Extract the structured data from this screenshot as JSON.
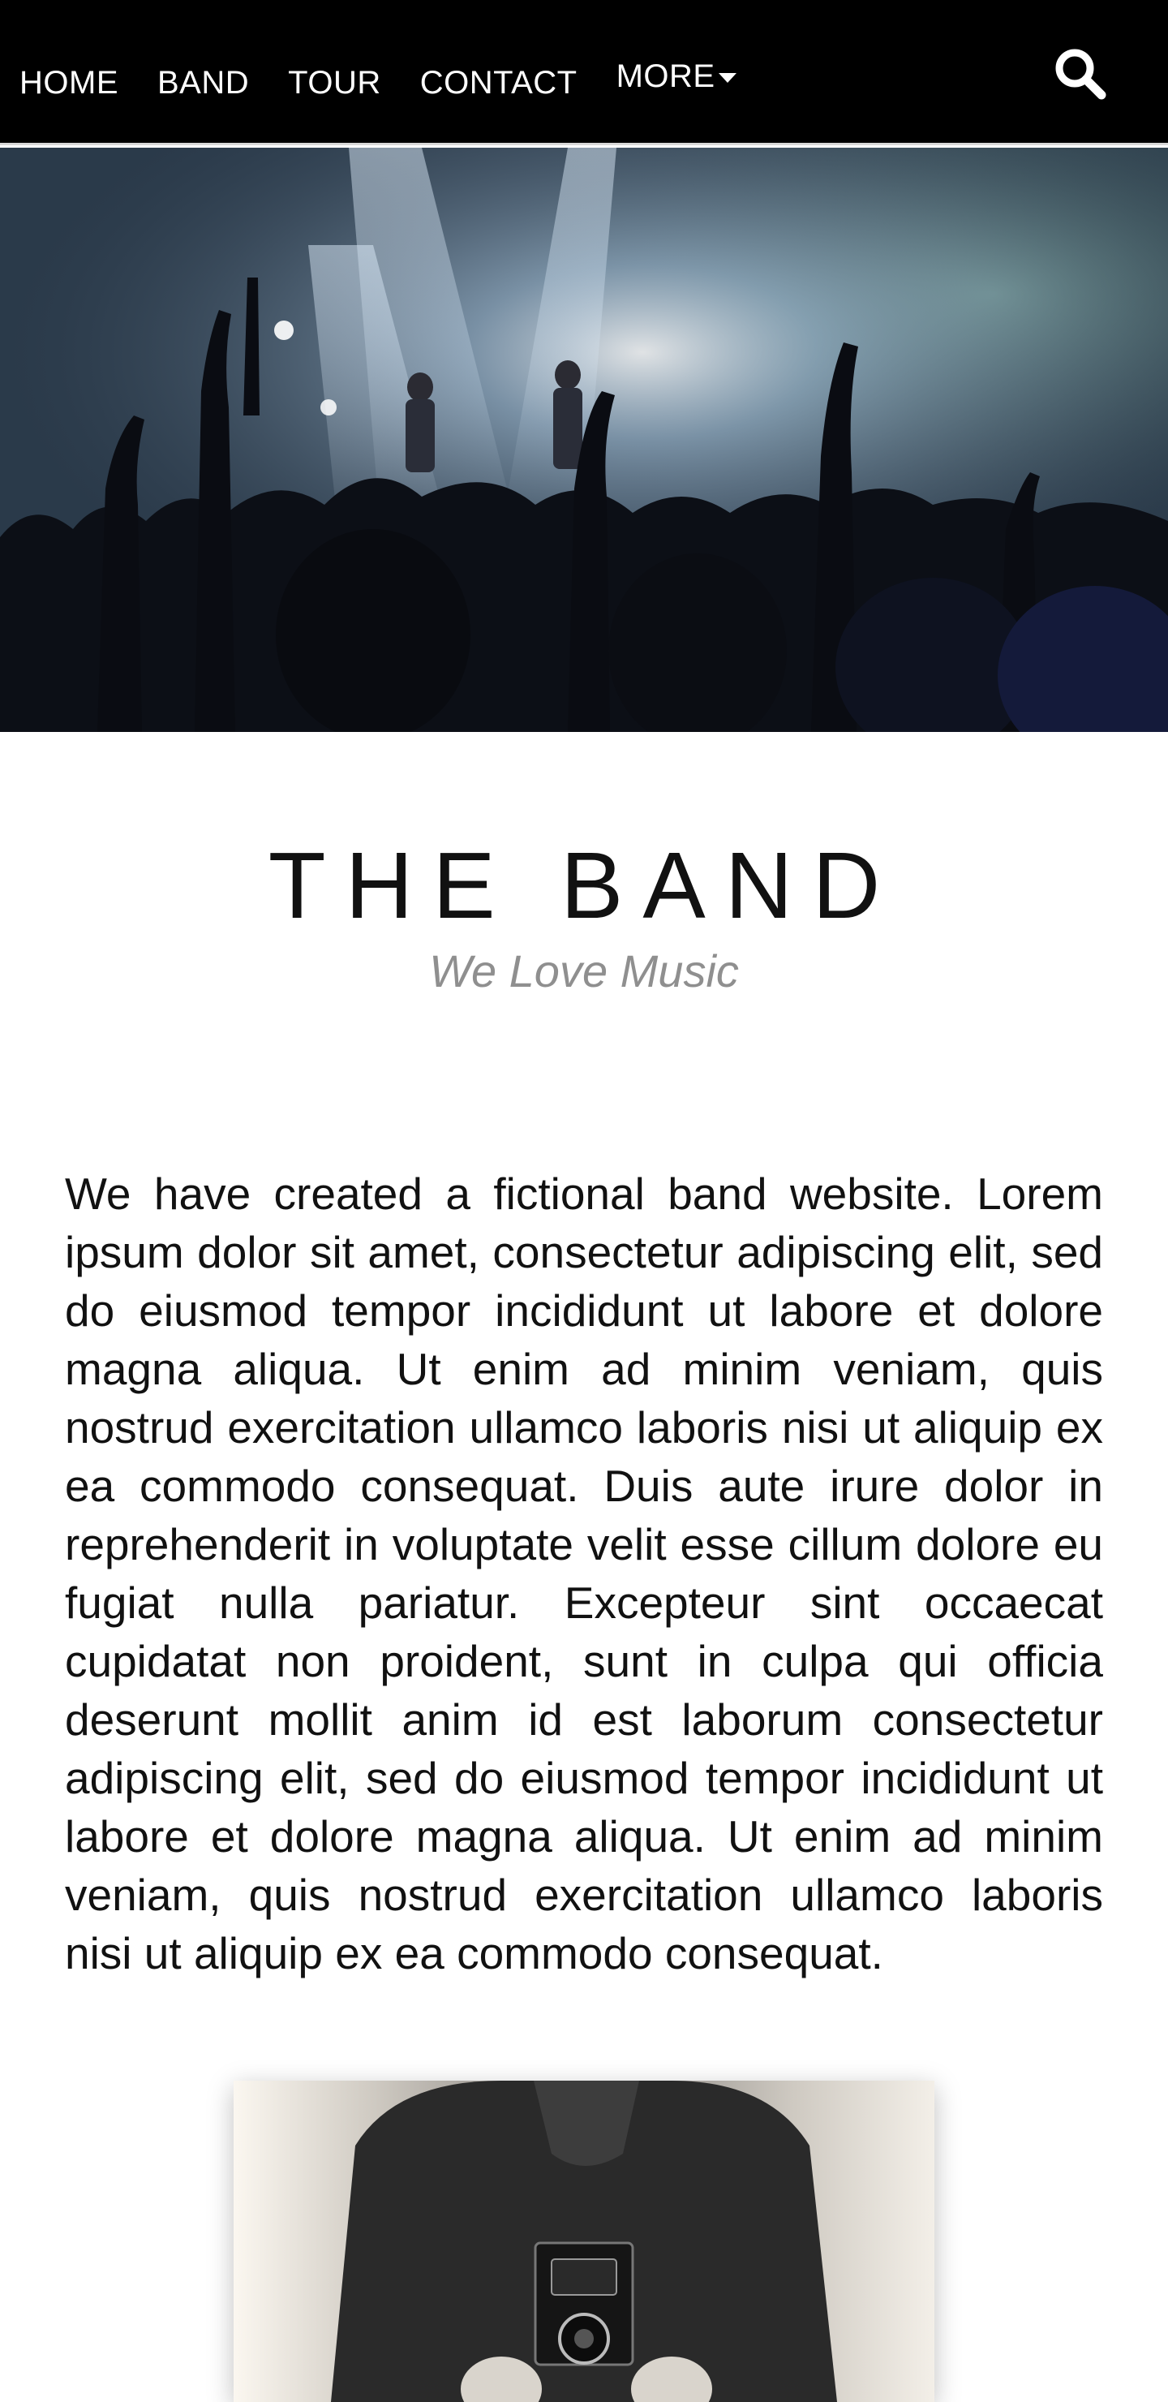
{
  "nav": {
    "items": [
      {
        "label": "HOME"
      },
      {
        "label": "BAND"
      },
      {
        "label": "TOUR"
      },
      {
        "label": "CONTACT"
      },
      {
        "label": "MORE"
      }
    ],
    "search_icon": "search-icon",
    "more_icon": "caret-down-icon"
  },
  "band": {
    "title": "THE BAND",
    "subtitle": "We Love Music",
    "text": "We have created a fictional band website. Lorem ipsum dolor sit amet, consectetur adipiscing elit, sed do eiusmod tempor incididunt ut labore et dolore magna aliqua. Ut enim ad minim veniam, quis nostrud exercitation ullamco laboris nisi ut aliquip ex ea commodo consequat. Duis aute irure dolor in reprehenderit in voluptate velit esse cillum dolore eu fugiat nulla pariatur. Excepteur sint occaecat cupidatat non proident, sunt in culpa qui officia deserunt mollit anim id est laborum consectetur adipiscing elit, sed do eiusmod tempor incididunt ut labore et dolore magna aliqua. Ut enim ad minim veniam, quis nostrud exercitation ullamco laboris nisi ut aliquip ex ea commodo consequat."
  },
  "colors": {
    "nav_background": "#000000",
    "nav_text": "#ffffff",
    "subtitle": "#8f8f8f",
    "body_text": "#111111"
  }
}
